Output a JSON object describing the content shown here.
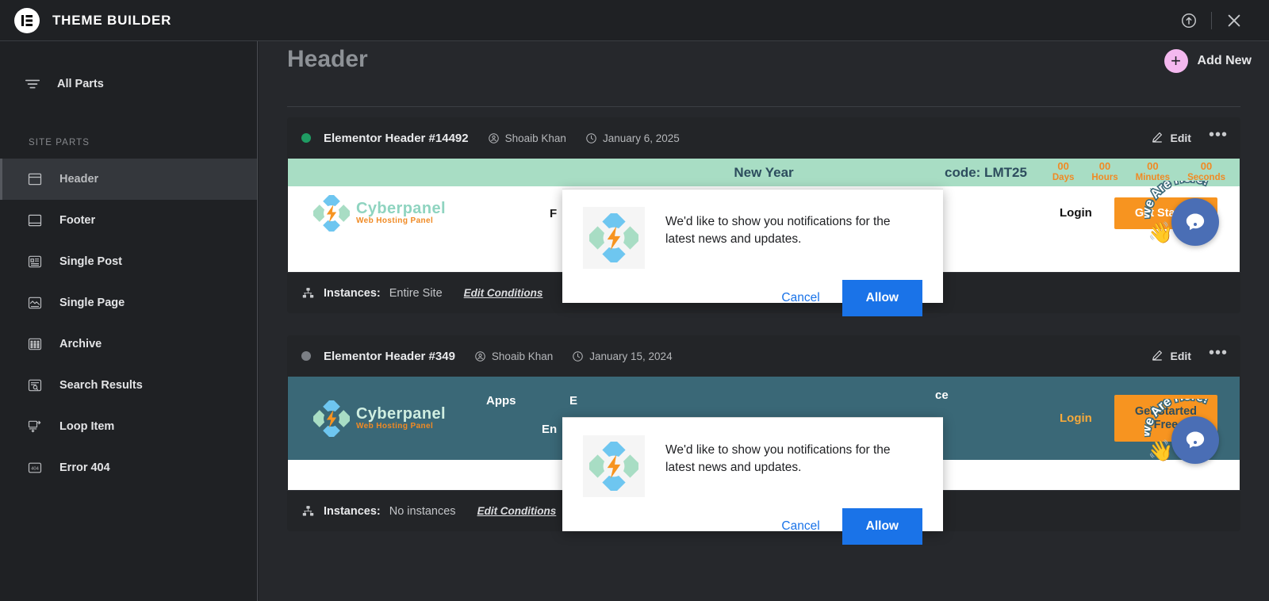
{
  "app": {
    "title": "THEME BUILDER",
    "logo_icon": "elementor-logo-icon",
    "help_icon": "help-circle-icon",
    "close_icon": "close-icon"
  },
  "sidebar": {
    "all_parts": {
      "label": "All Parts",
      "icon": "filter-lines-icon"
    },
    "section_label": "SITE PARTS",
    "items": [
      {
        "label": "Header",
        "icon": "header-layout-icon",
        "active": true
      },
      {
        "label": "Footer",
        "icon": "footer-layout-icon",
        "active": false
      },
      {
        "label": "Single Post",
        "icon": "single-post-icon",
        "active": false
      },
      {
        "label": "Single Page",
        "icon": "single-page-icon",
        "active": false
      },
      {
        "label": "Archive",
        "icon": "archive-grid-icon",
        "active": false
      },
      {
        "label": "Search Results",
        "icon": "search-results-icon",
        "active": false
      },
      {
        "label": "Loop Item",
        "icon": "loop-item-icon",
        "active": false
      },
      {
        "label": "Error 404",
        "icon": "error-404-icon",
        "active": false
      }
    ]
  },
  "main": {
    "page_title": "Header",
    "add_new": {
      "label": "Add New",
      "icon": "plus-icon",
      "color": "#f4b8ef"
    }
  },
  "cards": [
    {
      "title": "Elementor Header #14492",
      "status_color": "#1f9c63",
      "author": "Shoaib Khan",
      "author_icon": "user-circle-icon",
      "date": "January 6, 2025",
      "date_icon": "clock-icon",
      "edit_label": "Edit",
      "edit_icon": "pencil-icon",
      "more_icon": "ellipsis-icon",
      "instances_key": "Instances:",
      "instances_value": "Entire Site",
      "instances_icon": "sitemap-icon",
      "edit_conditions": "Edit Conditions",
      "preview": {
        "style": "light",
        "promo_text": "New Year",
        "promo_code": "code: LMT25",
        "promo_bg": "#a8ddc4",
        "countdown": [
          {
            "value": "00",
            "label": "Days"
          },
          {
            "value": "00",
            "label": "Hours"
          },
          {
            "value": "00",
            "label": "Minutes"
          },
          {
            "value": "00",
            "label": "Seconds"
          }
        ],
        "brand_name": "Cyberpanel",
        "brand_sub": "Web Hosting Panel",
        "mid_text": "F",
        "login": "Login",
        "cta": "Get Started",
        "sticker": "We Are Here!",
        "wave_icon": "waving-hand-icon",
        "chat_icon": "chat-bubble-icon"
      }
    },
    {
      "title": "Elementor Header #349",
      "status_color": "#7b7f85",
      "author": "Shoaib Khan",
      "author_icon": "user-circle-icon",
      "date": "January 15, 2024",
      "date_icon": "clock-icon",
      "edit_label": "Edit",
      "edit_icon": "pencil-icon",
      "more_icon": "ellipsis-icon",
      "instances_key": "Instances:",
      "instances_value": "No instances",
      "instances_icon": "sitemap-icon",
      "edit_conditions": "Edit Conditions",
      "preview": {
        "style": "dark",
        "nav_bg": "#3a6877",
        "brand_name": "Cyberpanel",
        "brand_sub": "Web Hosting Panel",
        "menu_apps": "Apps",
        "menu_partial_1": "E",
        "menu_partial_2": "En",
        "menu_partial_3": "ce",
        "login": "Login",
        "cta_line1": "Get Started",
        "cta_line2": "Free",
        "sticker": "We Are Here!",
        "wave_icon": "waving-hand-icon",
        "chat_icon": "chat-bubble-icon"
      }
    }
  ],
  "notification": {
    "message": "We'd like to show you notifications for the latest news and updates.",
    "cancel": "Cancel",
    "allow": "Allow",
    "icon": "cyberpanel-logo-icon",
    "allow_color": "#1a73e8"
  }
}
